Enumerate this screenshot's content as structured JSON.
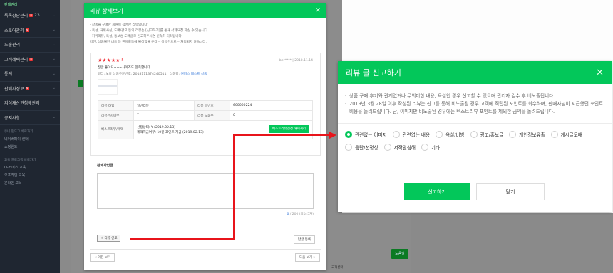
{
  "sidebar": {
    "top": "판매관리",
    "items": [
      {
        "label": "톡톡상담관리",
        "badge": "N",
        "count": "23"
      },
      {
        "label": "스토어관리",
        "badge": "N"
      },
      {
        "label": "노출관리"
      },
      {
        "label": "고객혜택관리",
        "badge": "N"
      },
      {
        "label": "통계"
      },
      {
        "label": "판매자정보",
        "badge": "N"
      },
      {
        "label": "지식재산권침해관리"
      },
      {
        "label": "공지사항"
      }
    ],
    "group1_title": "유니 펀드그 바로가기",
    "group1": [
      "네이버페이 센터",
      "쇼핑윈도"
    ],
    "group2_title": "교육 프로그램 바로가기",
    "group2": [
      "D-커머스 교육",
      "오프라인 교육",
      "온라인 교육"
    ]
  },
  "background": {
    "button": "도움말",
    "bottom_text": "고객센터"
  },
  "review_modal": {
    "title": "리뷰 상세보기",
    "notice": [
      "· 상품을 구매한 회원이 작성한 리뷰입니다.",
      "· 욕설, 허위사실, 도배/광고 등의 리뷰는 [신고하기]를 통해 삭제요청 하실 수 있습니다.",
      "· 허위리뷰, 욕설, 통보성 도배글로 신고해주시면 신속히 처리됩니다.",
      "  다만, 상품불만 내용 등 판매활동에 불이익을 준다는 이유만으로는 처리되지 않습니다."
    ],
    "stars": "★★★★★",
    "score": "5",
    "author_date": "be***** | 2018.11.14",
    "content": "정말 좋아요~~~사이즈도 만족합니다.",
    "option": "컬러: 노랑    상품주문번호: 2018111374240511  |  상품명: ",
    "product_link": "원피스 테스트 상품",
    "table": {
      "r1": [
        "리뷰 타입",
        "일반리뷰",
        "리뷰 글번호",
        "600000224"
      ],
      "r2": [
        "리뷰전시여부",
        "Y",
        "리뷰 도움수",
        "0"
      ],
      "r3_label": "베스트리뷰/혜택",
      "r3_value1": "선정상태: Y (2019.02.13)",
      "r3_value2": "혜택지급여부: 10원 포인트 지급 (2019.02.13)",
      "r3_button": "베스트리뷰선정 해제처리"
    },
    "reply_title": "판매자답글",
    "reply_count": "0",
    "reply_limit": " / 200 (최소 5자)",
    "report_button": "⚠ 리뷰 신고",
    "reply_button": "답글 등록",
    "prev": "< 이전 보기",
    "next": "다음 보기 >"
  },
  "report_modal": {
    "title": "리뷰 글 신고하기",
    "notice": [
      "상품 구매 후기와 관계없거나 무의미한 내용, 욕설인 경우 신고할 수 있으며 관리자 검수 후 비노출됩니다.",
      "2019년 3월 28일 이후 작성된 리뷰는 신고를 통해 비노출될 경우 고객에 적립된 포인트를 회수하며, 판매자님이 지급했던 포인트 비용을 돌려드립니다. 단, 이미지만 비노출된 경우에는 텍스트리뷰 포인트를 제외한 금액을 돌려드립니다."
    ],
    "reasons": [
      "관련없는 이미지",
      "관련없는 내용",
      "욕설/비방",
      "광고/홍보글",
      "개인정보유출",
      "게시글도배",
      "음란/선정성",
      "저작권침해",
      "기타"
    ],
    "selected": "관련없는 이미지",
    "confirm": "신고하기",
    "close": "닫기"
  },
  "colors": {
    "accent": "#03c75a",
    "alert": "#e8141b"
  }
}
